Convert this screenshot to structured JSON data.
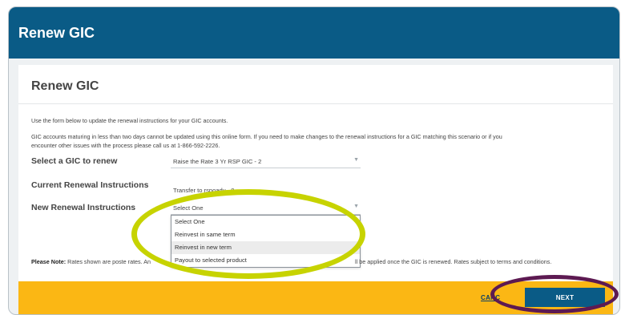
{
  "header": {
    "title": "Renew GIC"
  },
  "card": {
    "title": "Renew GIC",
    "intro": "Use the form below to update the renewal instructions for your GIC accounts.",
    "note_line1": "GIC accounts maturing in less than two days cannot be updated using this online form. If you need to make changes to the renewal instructions for a GIC matching this scenario or if you",
    "note_line2": "encounter other issues with the process please call us at 1-866-592-2226."
  },
  "form": {
    "select_gic": {
      "label": "Select a GIC to renew",
      "value": "Raise the Rate 3 Yr RSP GIC - 2"
    },
    "current": {
      "label": "Current Renewal Instructions",
      "value": "Transfer to rspoadv - 0"
    },
    "new": {
      "label": "New Renewal Instructions",
      "value": "Select One",
      "options": [
        "Select One",
        "Reinvest in same term",
        "Reinvest in new term",
        "Payout to selected product"
      ],
      "highlighted": "Reinvest in new term"
    }
  },
  "please_note": {
    "bold": "Please Note:",
    "text_left": "Rates shown are poste",
    "text_mid": "rates. An",
    "text_right": "ll be applied once the GIC is renewed. Rates subject to terms and conditions."
  },
  "footer": {
    "cancel_label": "CANC",
    "next_label": "NEXT"
  },
  "colors": {
    "brand_blue": "#0a5b86",
    "footer_yellow": "#fbb714",
    "annotation_green": "#c7d300",
    "annotation_purple": "#5d1a52"
  }
}
